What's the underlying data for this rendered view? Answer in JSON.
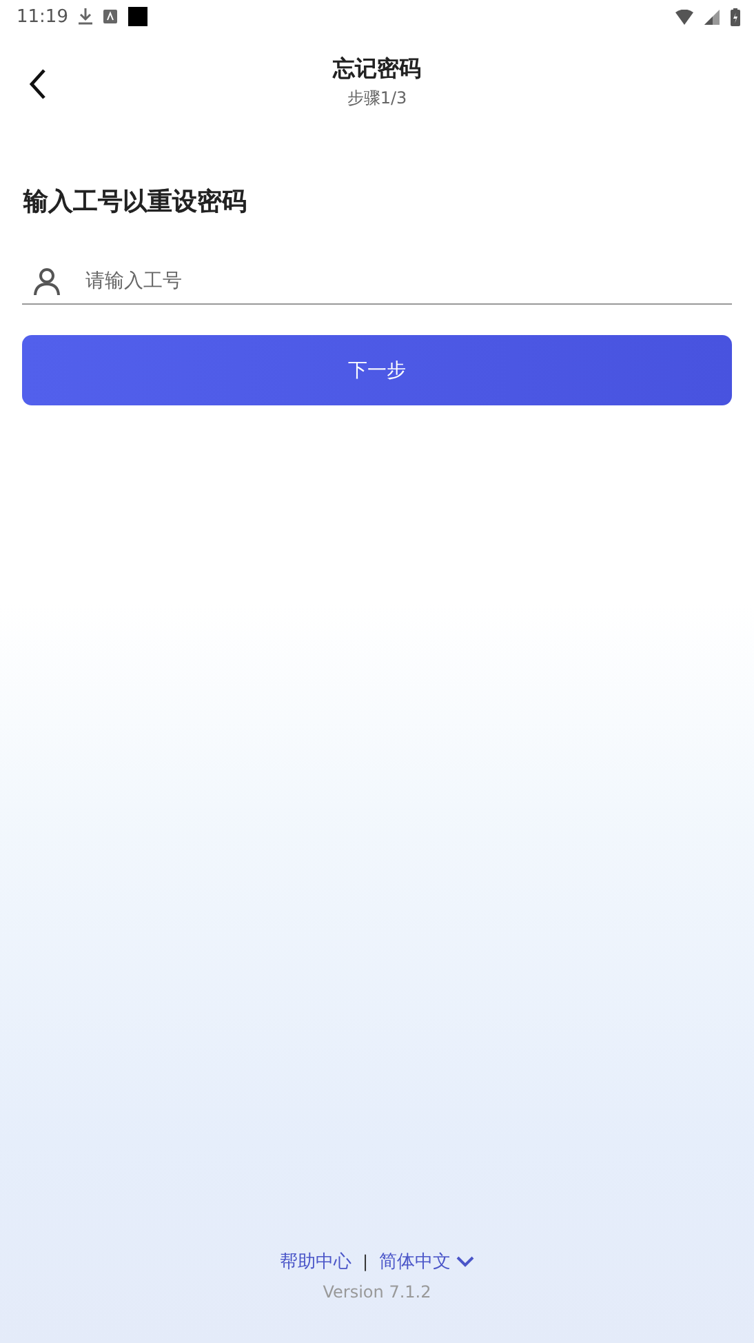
{
  "status_bar": {
    "time": "11:19"
  },
  "header": {
    "title": "忘记密码",
    "subtitle": "步骤1/3"
  },
  "heading": "输入工号以重设密码",
  "employee_id_field": {
    "placeholder": "请输入工号"
  },
  "next_button": {
    "label": "下一步"
  },
  "footer": {
    "help_link": "帮助中心",
    "separator": "|",
    "language": "简体中文",
    "version": "Version 7.1.2"
  }
}
